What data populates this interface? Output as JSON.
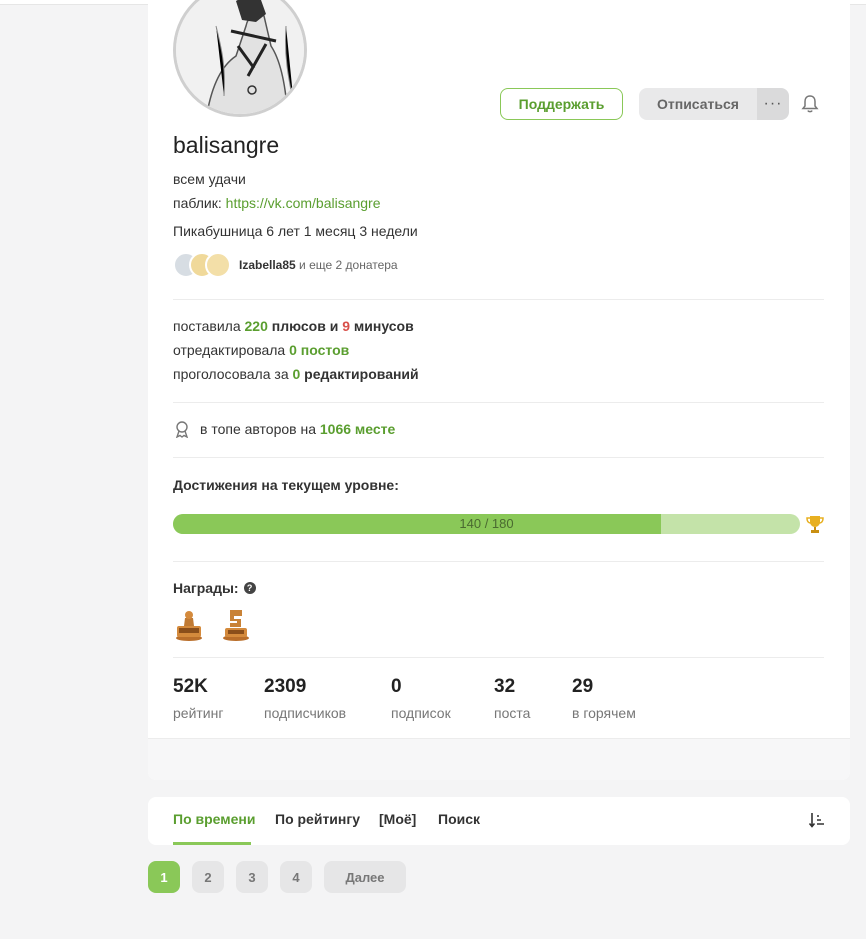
{
  "profile": {
    "username": "balisangre",
    "bio": "всем удачи",
    "public_label": "паблик: ",
    "public_link": "https://vk.com/balisangre",
    "membership": "Пикабушница 6 лет 1 месяц 3 недели",
    "donor_name": "Izabella85",
    "donor_more": "и еще 2 донатера"
  },
  "actions": {
    "support_label": "Поддержать",
    "unsubscribe_label": "Отписаться",
    "more_label": "···"
  },
  "activity": {
    "line1_prefix": "поставила ",
    "pluses": "220",
    "line1_mid": " плюсов и ",
    "minuses": "9",
    "line1_suffix": " минусов",
    "line2_prefix": "отредактировала ",
    "edits": "0 постов",
    "line3_prefix": "проголосовала за ",
    "votes": "0",
    "line3_suffix": " редактирований"
  },
  "rank": {
    "prefix": "в топе авторов на ",
    "place": "1066 месте"
  },
  "achievements": {
    "title": "Достижения на текущем уровне:",
    "progress_label": "140 / 180",
    "progress_fraction": 0.7778
  },
  "awards": {
    "title": "Награды:",
    "items": [
      "award-100-icon",
      "award-5-years-icon"
    ]
  },
  "stats": [
    {
      "value": "52K",
      "label": "рейтинг"
    },
    {
      "value": "2309",
      "label": "подписчиков"
    },
    {
      "value": "0",
      "label": "подписок"
    },
    {
      "value": "32",
      "label": "поста"
    },
    {
      "value": "29",
      "label": "в горячем"
    }
  ],
  "tabs": [
    {
      "label": "По времени",
      "active": true
    },
    {
      "label": "По рейтингу"
    },
    {
      "label": "[Моё]"
    },
    {
      "label": "Поиск"
    }
  ],
  "pagination": {
    "pages": [
      "1",
      "2",
      "3",
      "4"
    ],
    "next_label": "Далее",
    "current": "1"
  },
  "colors": {
    "accent": "#8ac858",
    "accent_text": "#5a9e2f",
    "minus": "#d8504a"
  }
}
